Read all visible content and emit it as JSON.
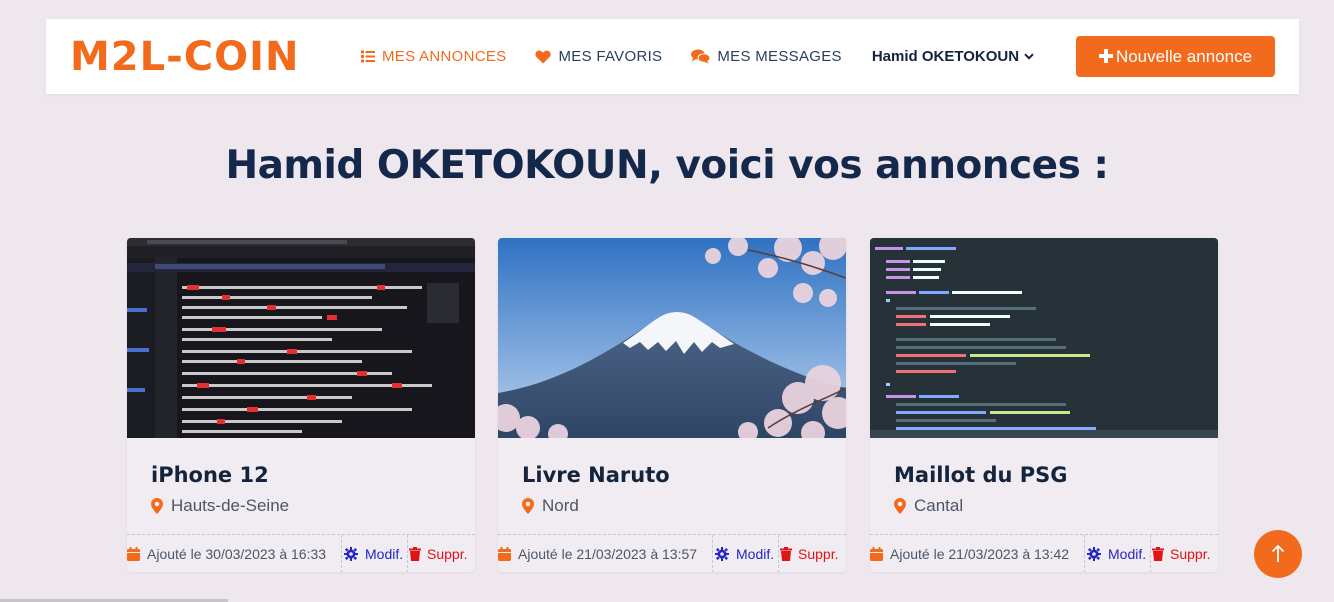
{
  "brand": {
    "name": "M2L-COIN",
    "accent": "#f26b1d"
  },
  "nav": {
    "items": [
      {
        "label": "MES ANNONCES",
        "icon": "list-icon",
        "active": true
      },
      {
        "label": "MES FAVORIS",
        "icon": "heart-icon",
        "active": false
      },
      {
        "label": "MES MESSAGES",
        "icon": "comments-icon",
        "active": false
      }
    ],
    "user": {
      "name": "Hamid OKETOKOUN",
      "icon": "chevron-down-icon"
    },
    "new_listing": {
      "label": "Nouvelle annonce",
      "icon": "plus-icon"
    }
  },
  "page": {
    "title": "Hamid OKETOKOUN, voici vos annonces :"
  },
  "listings": [
    {
      "title": "iPhone 12",
      "location": "Hauts-de-Seine",
      "date": "Ajouté le 30/03/2023 à 16:33",
      "edit_label": "Modif.",
      "delete_label": "Suppr.",
      "image": "screenshot-code-editor"
    },
    {
      "title": "Livre Naruto",
      "location": "Nord",
      "date": "Ajouté le 21/03/2023 à 13:57",
      "edit_label": "Modif.",
      "delete_label": "Suppr.",
      "image": "mount-fuji-cherry-blossoms"
    },
    {
      "title": "Maillot du PSG",
      "location": "Cantal",
      "date": "Ajouté le 21/03/2023 à 13:42",
      "edit_label": "Modif.",
      "delete_label": "Suppr.",
      "image": "php-code-screenshot"
    }
  ],
  "colors": {
    "edit": "#2525c8",
    "delete": "#e01414",
    "accent": "#f26b1d"
  },
  "scroll_top": {
    "icon": "arrow-up-icon"
  }
}
